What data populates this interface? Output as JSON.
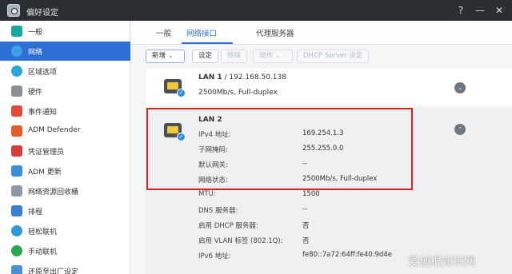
{
  "window": {
    "title": "偏好设定",
    "buttons": [
      "?",
      "—",
      "✕"
    ]
  },
  "sidebar": {
    "items": [
      {
        "label": "一般",
        "icon": "general-icon",
        "color": "#18a8a0"
      },
      {
        "label": "网络",
        "icon": "globe-icon",
        "color": "#3aa0e8",
        "active": true
      },
      {
        "label": "区域选项",
        "icon": "region-icon",
        "color": "#2aa6d8"
      },
      {
        "label": "硬件",
        "icon": "hardware-icon",
        "color": "#8a8f96"
      },
      {
        "label": "事件通知",
        "icon": "notification-icon",
        "color": "#e24b3b"
      },
      {
        "label": "ADM Defender",
        "icon": "shield-icon",
        "color": "#e25d2d"
      },
      {
        "label": "凭证管理员",
        "icon": "certificate-icon",
        "color": "#d63c3c"
      },
      {
        "label": "ADM 更新",
        "icon": "update-icon",
        "color": "#3a8fd8"
      },
      {
        "label": "网络资源回收桶",
        "icon": "recycle-icon",
        "color": "#8d9aa6"
      },
      {
        "label": "排程",
        "icon": "calendar-icon",
        "color": "#3a7fd0"
      },
      {
        "label": "轻松联机",
        "icon": "cloud-icon",
        "color": "#2f9bd8"
      },
      {
        "label": "手动联机",
        "icon": "manual-connect-icon",
        "color": "#2aa84a"
      },
      {
        "label": "还原至出厂设定",
        "icon": "reset-icon",
        "color": "#4a8fd8"
      }
    ]
  },
  "tabs": [
    {
      "label": "一般"
    },
    {
      "label": "网络接口",
      "active": true
    },
    {
      "label": "代理服务器"
    }
  ],
  "toolbar": {
    "new_label": "新增",
    "settings_label": "设定",
    "remove_label": "移除",
    "action_label": "动作",
    "dhcp_label": "DHCP Server 设定"
  },
  "lan1": {
    "name": "LAN 1",
    "ip": " / 192.168.50.138",
    "status": "2500Mb/s, Full-duplex"
  },
  "lan2": {
    "name": "LAN 2",
    "rows": [
      {
        "label": "IPv4 地址:",
        "value": "169.254.1.3"
      },
      {
        "label": "子网掩码:",
        "value": "255.255.0.0"
      },
      {
        "label": "默认网关:",
        "value": "--"
      },
      {
        "label": "网络状态:",
        "value": "2500Mb/s, Full-duplex"
      },
      {
        "label": "MTU:",
        "value": "1500"
      },
      {
        "label": "DNS 服务器:",
        "value": "--"
      },
      {
        "label": "启用 DHCP 服务器:",
        "value": "否"
      },
      {
        "label": "启用 VLAN 标签 (802.1Q):",
        "value": "否"
      },
      {
        "label": "IPv6 地址:",
        "value": "fe80::7a72:64ff:fe40:9d4e"
      }
    ]
  },
  "watermark": "爱创根知识网",
  "colors": {
    "accent": "#2e6fd6",
    "titlebar": "#2b2f33",
    "highlight": "#e02020"
  }
}
